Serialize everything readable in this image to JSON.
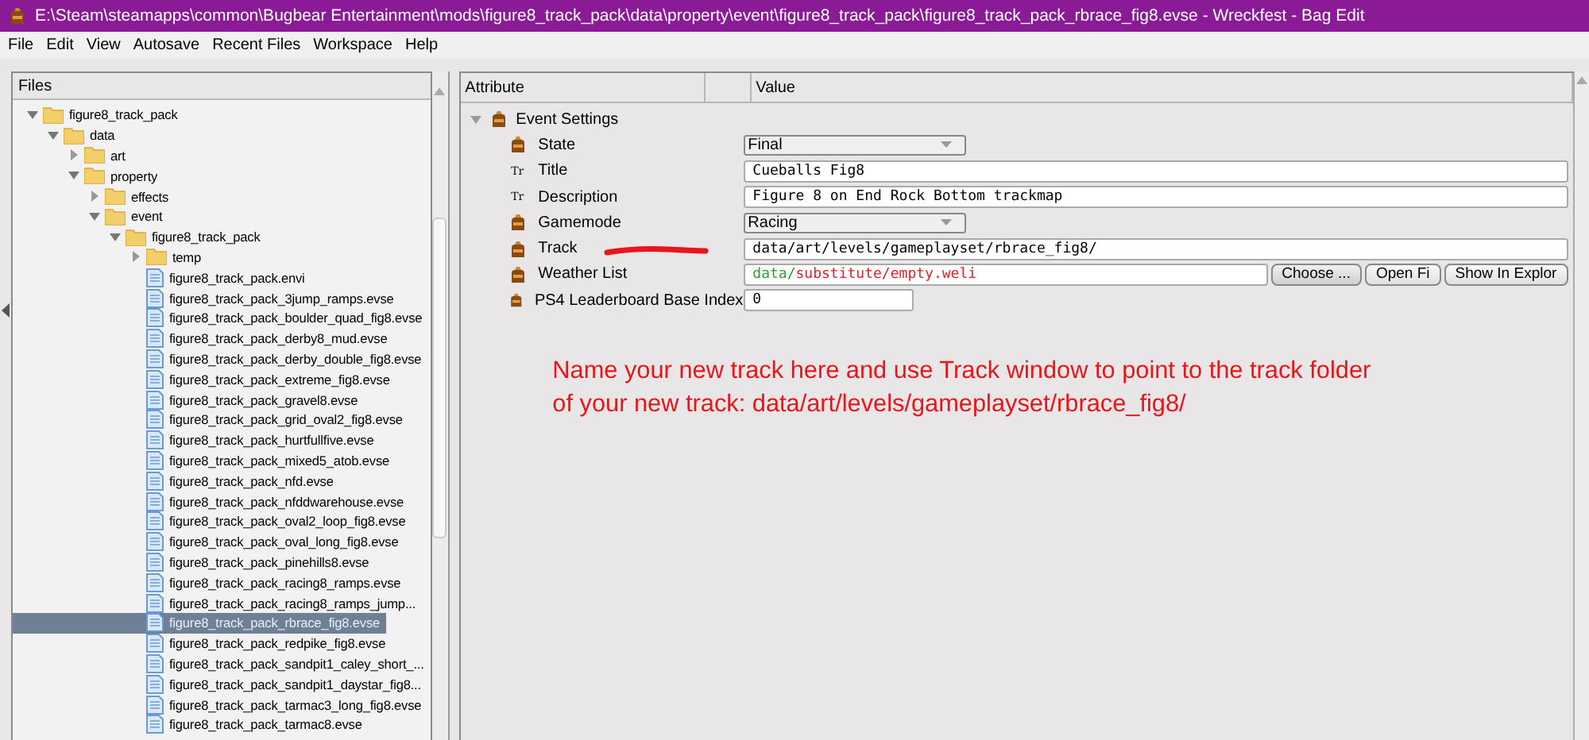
{
  "window": {
    "title": "E:\\Steam\\steamapps\\common\\Bugbear Entertainment\\mods\\figure8_track_pack\\data\\property\\event\\figure8_track_pack\\figure8_track_pack_rbrace_fig8.evse - Wreckfest - Bag Edit"
  },
  "menu": [
    "File",
    "Edit",
    "View",
    "Autosave",
    "Recent Files",
    "Workspace",
    "Help"
  ],
  "files_panel": {
    "header": "Files",
    "tree": [
      {
        "label": "figure8_track_pack",
        "kind": "folder",
        "expanded": true,
        "selected": false,
        "children": [
          {
            "label": "data",
            "kind": "folder",
            "expanded": true,
            "selected": false,
            "children": [
              {
                "label": "art",
                "kind": "folder",
                "expanded": false,
                "selected": false
              },
              {
                "label": "property",
                "kind": "folder",
                "expanded": true,
                "selected": false,
                "children": [
                  {
                    "label": "effects",
                    "kind": "folder",
                    "expanded": false,
                    "selected": false
                  },
                  {
                    "label": "event",
                    "kind": "folder",
                    "expanded": true,
                    "selected": false,
                    "children": [
                      {
                        "label": "figure8_track_pack",
                        "kind": "folder",
                        "expanded": true,
                        "selected": false,
                        "children": [
                          {
                            "label": "temp",
                            "kind": "folder",
                            "expanded": false,
                            "selected": false
                          },
                          {
                            "label": "figure8_track_pack.envi",
                            "kind": "file",
                            "selected": false
                          },
                          {
                            "label": "figure8_track_pack_3jump_ramps.evse",
                            "kind": "file",
                            "selected": false
                          },
                          {
                            "label": "figure8_track_pack_boulder_quad_fig8.evse",
                            "kind": "file",
                            "selected": false
                          },
                          {
                            "label": "figure8_track_pack_derby8_mud.evse",
                            "kind": "file",
                            "selected": false
                          },
                          {
                            "label": "figure8_track_pack_derby_double_fig8.evse",
                            "kind": "file",
                            "selected": false
                          },
                          {
                            "label": "figure8_track_pack_extreme_fig8.evse",
                            "kind": "file",
                            "selected": false
                          },
                          {
                            "label": "figure8_track_pack_gravel8.evse",
                            "kind": "file",
                            "selected": false
                          },
                          {
                            "label": "figure8_track_pack_grid_oval2_fig8.evse",
                            "kind": "file",
                            "selected": false
                          },
                          {
                            "label": "figure8_track_pack_hurtfullfive.evse",
                            "kind": "file",
                            "selected": false
                          },
                          {
                            "label": "figure8_track_pack_mixed5_atob.evse",
                            "kind": "file",
                            "selected": false
                          },
                          {
                            "label": "figure8_track_pack_nfd.evse",
                            "kind": "file",
                            "selected": false
                          },
                          {
                            "label": "figure8_track_pack_nfddwarehouse.evse",
                            "kind": "file",
                            "selected": false
                          },
                          {
                            "label": "figure8_track_pack_oval2_loop_fig8.evse",
                            "kind": "file",
                            "selected": false
                          },
                          {
                            "label": "figure8_track_pack_oval_long_fig8.evse",
                            "kind": "file",
                            "selected": false
                          },
                          {
                            "label": "figure8_track_pack_pinehills8.evse",
                            "kind": "file",
                            "selected": false
                          },
                          {
                            "label": "figure8_track_pack_racing8_ramps.evse",
                            "kind": "file",
                            "selected": false
                          },
                          {
                            "label": "figure8_track_pack_racing8_ramps_jump...",
                            "kind": "file",
                            "selected": false
                          },
                          {
                            "label": "figure8_track_pack_rbrace_fig8.evse",
                            "kind": "file",
                            "selected": true
                          },
                          {
                            "label": "figure8_track_pack_redpike_fig8.evse",
                            "kind": "file",
                            "selected": false
                          },
                          {
                            "label": "figure8_track_pack_sandpit1_caley_short_...",
                            "kind": "file",
                            "selected": false
                          },
                          {
                            "label": "figure8_track_pack_sandpit1_daystar_fig8...",
                            "kind": "file",
                            "selected": false
                          },
                          {
                            "label": "figure8_track_pack_tarmac3_long_fig8.evse",
                            "kind": "file",
                            "selected": false
                          },
                          {
                            "label": "figure8_track_pack_tarmac8.evse",
                            "kind": "file",
                            "selected": false
                          }
                        ]
                      }
                    ]
                  }
                ]
              }
            ]
          }
        ]
      }
    ]
  },
  "properties": {
    "columns": [
      "Attribute",
      "Value"
    ],
    "group": {
      "label": "Event Settings",
      "expanded": true
    },
    "rows": [
      {
        "label": "State",
        "kind": "dropdown",
        "value": "Final"
      },
      {
        "label": "Title",
        "kind": "text",
        "type_icon": "Tr",
        "value": "Cueballs Fig8"
      },
      {
        "label": "Description",
        "kind": "text",
        "type_icon": "Tr",
        "value": "Figure 8 on End Rock Bottom trackmap"
      },
      {
        "label": "Gamemode",
        "kind": "dropdown",
        "value": "Racing"
      },
      {
        "label": "Track",
        "kind": "path",
        "value": "data/art/levels/gameplayset/rbrace_fig8/"
      },
      {
        "label": "Weather List",
        "kind": "file_path",
        "value_parts": [
          {
            "text": "data/",
            "color": "#2e9e2e"
          },
          {
            "text": "substitute/empty.weli",
            "color": "#e0202a"
          }
        ],
        "buttons": [
          "Choose ...",
          "Open Fi",
          "Show In Explor"
        ]
      },
      {
        "label": "PS4 Leaderboard Base Index",
        "kind": "number",
        "value": "0"
      }
    ]
  },
  "annotation": [
    "Name your new track here and use Track window to point to the track folder",
    "of your new track: data/art/levels/gameplayset/rbrace_fig8/"
  ]
}
